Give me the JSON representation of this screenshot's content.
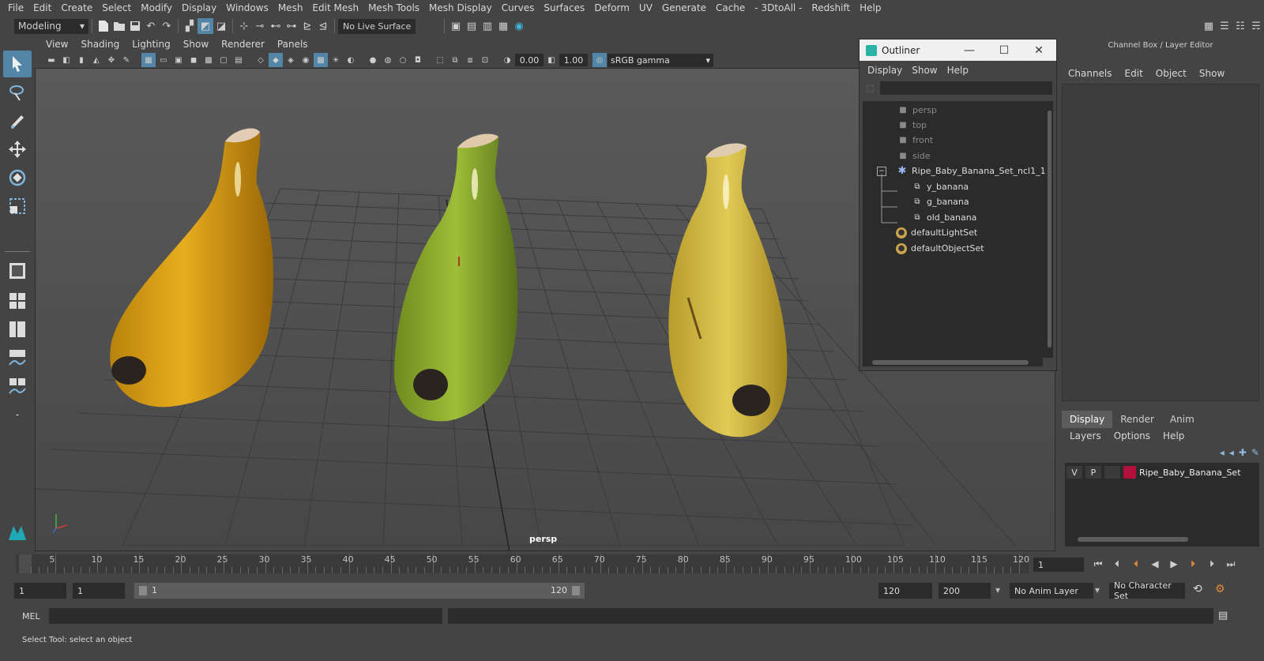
{
  "menubar": {
    "items": [
      "File",
      "Edit",
      "Create",
      "Select",
      "Modify",
      "Display",
      "Windows",
      "Mesh",
      "Edit Mesh",
      "Mesh Tools",
      "Mesh Display",
      "Curves",
      "Surfaces",
      "Deform",
      "UV",
      "Generate",
      "Cache",
      "- 3DtoAll -",
      "Redshift",
      "Help"
    ]
  },
  "statusline": {
    "menuset": "Modeling",
    "live_surface": "No Live Surface"
  },
  "panel": {
    "menu": [
      "View",
      "Shading",
      "Lighting",
      "Show",
      "Renderer",
      "Panels"
    ],
    "exposure": "0.00",
    "gamma": "1.00",
    "colorspace": "sRGB gamma",
    "camera_label": "persp"
  },
  "outliner": {
    "title": "Outliner",
    "menu": [
      "Display",
      "Show",
      "Help"
    ],
    "items": [
      {
        "label": "persp",
        "dim": true
      },
      {
        "label": "top",
        "dim": true
      },
      {
        "label": "front",
        "dim": true
      },
      {
        "label": "side",
        "dim": true
      },
      {
        "label": "Ripe_Baby_Banana_Set_ncl1_1",
        "dim": false
      },
      {
        "label": "y_banana",
        "dim": false
      },
      {
        "label": "g_banana",
        "dim": false
      },
      {
        "label": "old_banana",
        "dim": false
      },
      {
        "label": "defaultLightSet",
        "dim": false
      },
      {
        "label": "defaultObjectSet",
        "dim": false
      }
    ]
  },
  "channelbox": {
    "title": "Channel Box / Layer Editor",
    "menu": [
      "Channels",
      "Edit",
      "Object",
      "Show"
    ],
    "tabs": [
      "Display",
      "Render",
      "Anim"
    ],
    "layer_menu": [
      "Layers",
      "Options",
      "Help"
    ],
    "layer": {
      "v": "V",
      "p": "P",
      "name": "Ripe_Baby_Banana_Set",
      "color": "#b0103a"
    }
  },
  "timeslider": {
    "labels": [
      "5",
      "10",
      "15",
      "20",
      "25",
      "30",
      "35",
      "40",
      "45",
      "50",
      "55",
      "60",
      "65",
      "70",
      "75",
      "80",
      "85",
      "90",
      "95",
      "100",
      "105",
      "110",
      "115",
      "120"
    ],
    "start_label": "1",
    "current_frame": "1"
  },
  "rangeslider": {
    "start": "1",
    "playback_start": "1",
    "bar_start": "1",
    "bar_end": "120",
    "playback_end": "120",
    "end": "200",
    "anim_layer": "No Anim Layer",
    "character_set": "No Character Set"
  },
  "cmdline": {
    "label": "MEL"
  },
  "helpline": {
    "text": "Select Tool: select an object"
  }
}
